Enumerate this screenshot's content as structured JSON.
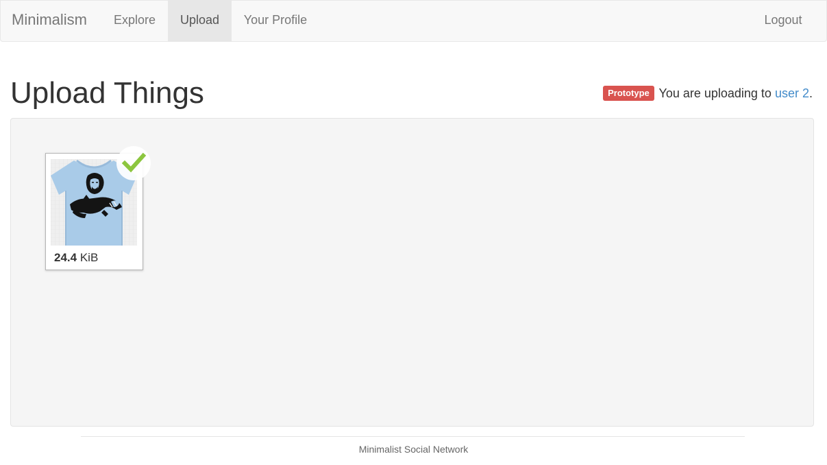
{
  "nav": {
    "brand": "Minimalism",
    "items": [
      "Explore",
      "Upload",
      "Your Profile"
    ],
    "active": "Upload",
    "logout": "Logout"
  },
  "header": {
    "title": "Upload Things",
    "badge": "Prototype",
    "note_prefix": "You are uploading to ",
    "user_link": "user 2",
    "note_suffix": "."
  },
  "uploads": [
    {
      "size_value": "24.4",
      "size_unit": "KiB",
      "status": "success",
      "thumbnail": "light-blue t-shirt with black-and-white portrait print"
    }
  ],
  "footer": {
    "text": "Minimalist Social Network"
  },
  "colors": {
    "badge": "#d9534f",
    "link": "#428bca",
    "success": "#8cc63f",
    "shirt": "#a9cbe8"
  },
  "icons": {
    "success": "check-icon"
  }
}
